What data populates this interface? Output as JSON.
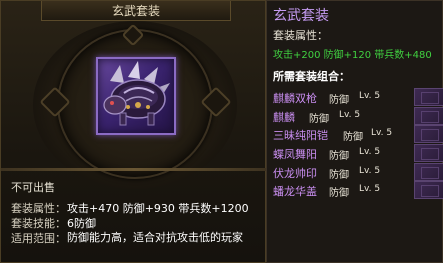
{
  "item": {
    "title": "玄武套装",
    "icon": "armored-beast-armor-icon",
    "trade_status": "不可出售",
    "rows": [
      {
        "label": "套装属性：",
        "value": "攻击+470 防御+930 带兵数+1200"
      },
      {
        "label": "套装技能：",
        "value": "6防御"
      },
      {
        "label": "适用范围：",
        "value": "防御能力高，适合对抗攻击低的玩家"
      }
    ]
  },
  "set": {
    "title": "玄武套装",
    "attr_label": "套装属性：",
    "attrs": "攻击+200 防御+120 带兵数+480",
    "required_label": "所需套装组合：",
    "pieces": [
      {
        "name": "麒麟双枪",
        "slot": "防御",
        "level": "Lv. 5"
      },
      {
        "name": "麒麟",
        "slot": "防御",
        "level": "Lv. 5"
      },
      {
        "name": "三昧纯阳铠",
        "slot": "防御",
        "level": "Lv. 5"
      },
      {
        "name": "蝶凤舞阳",
        "slot": "防御",
        "level": "Lv. 5"
      },
      {
        "name": "伏龙帅印",
        "slot": "防御",
        "level": "Lv. 5"
      },
      {
        "name": "蟠龙华盖",
        "slot": "防御",
        "level": "Lv. 5"
      }
    ]
  },
  "colors": {
    "set_name": "#c69cf4",
    "bonus_green": "#40d040",
    "piece_name": "#c98ef0"
  }
}
